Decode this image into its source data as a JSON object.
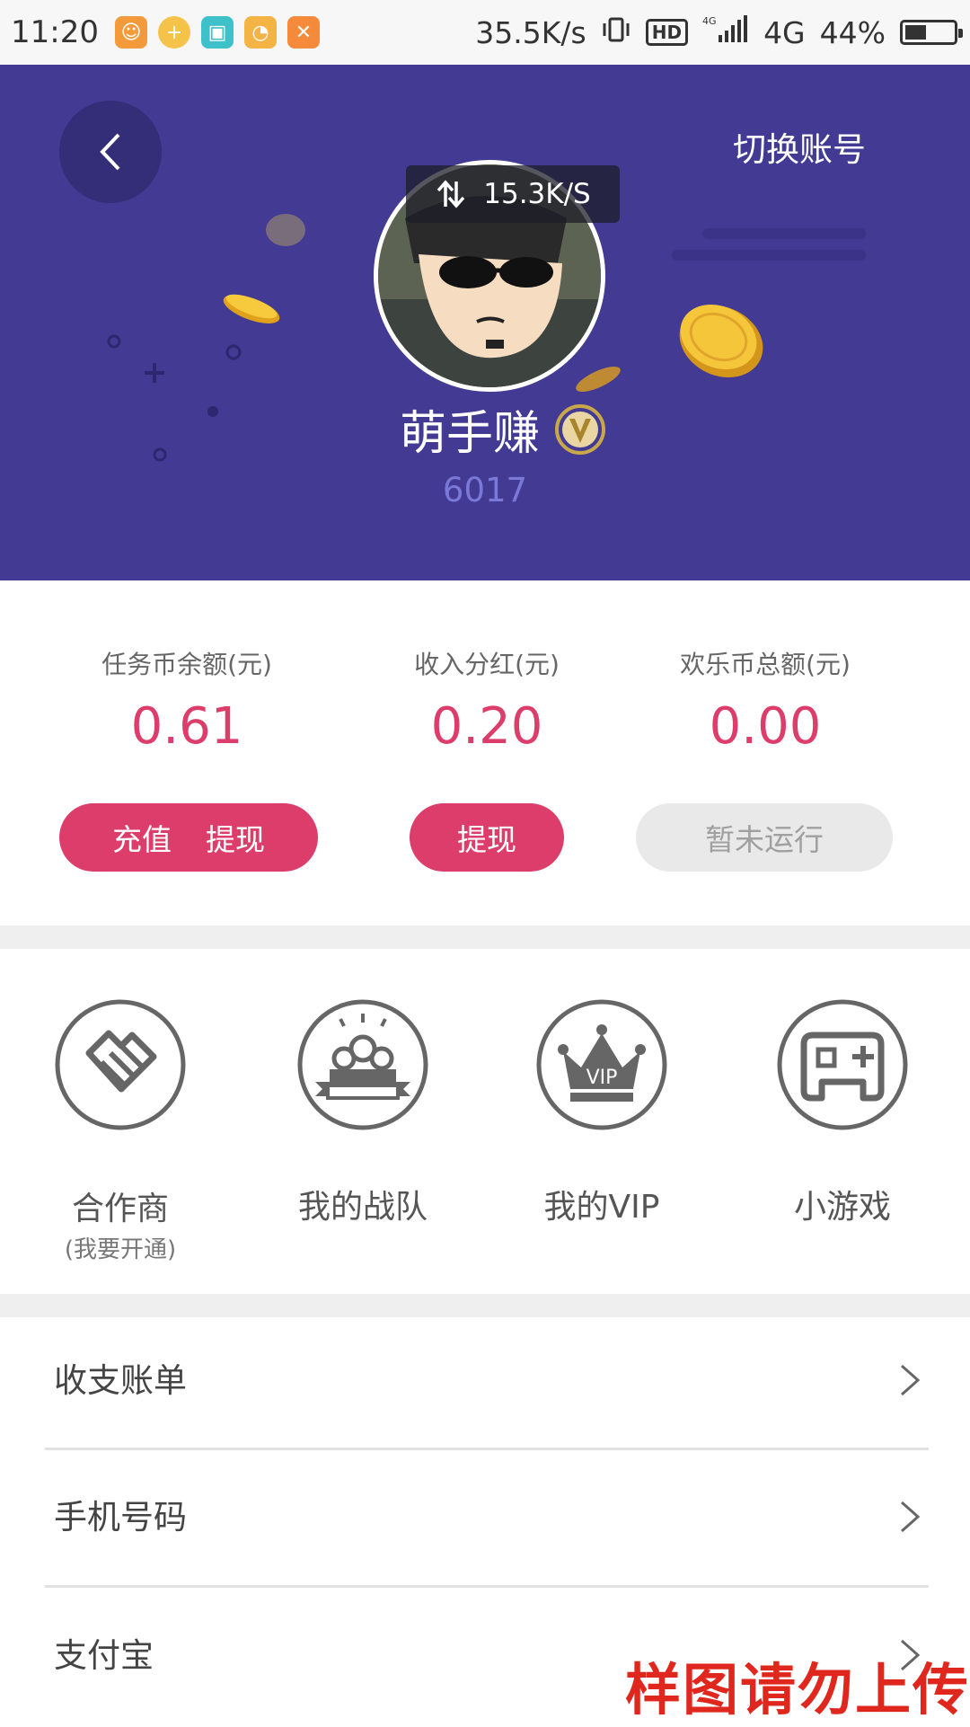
{
  "status_bar": {
    "time": "11:20",
    "network_speed": "35.5K/s",
    "hd": "HD",
    "network_type": "4G",
    "battery": "44%",
    "battery_level": 0.44,
    "app_icons": [
      "app-icon-orange",
      "app-icon-plus",
      "app-icon-scan",
      "app-icon-clock",
      "app-icon-shuffle"
    ]
  },
  "header": {
    "switch_account": "切换账号",
    "speed_overlay": "15.3K/S",
    "username": "萌手赚",
    "user_id": "6017",
    "background_color": "#423a93"
  },
  "balances": [
    {
      "label": "任务币余额(元)",
      "value": "0.61"
    },
    {
      "label": "收入分红(元)",
      "value": "0.20"
    },
    {
      "label": "欢乐币总额(元)",
      "value": "0.00"
    }
  ],
  "buttons": {
    "recharge": "充值",
    "withdraw_task": "提现",
    "withdraw_income": "提现",
    "not_running": "暂未运行"
  },
  "features": [
    {
      "label": "合作商",
      "sublabel": "(我要开通)",
      "icon": "handshake-icon"
    },
    {
      "label": "我的战队",
      "icon": "team-icon"
    },
    {
      "label": "我的VIP",
      "icon": "crown-icon",
      "icon_text": "VIP"
    },
    {
      "label": "小游戏",
      "icon": "gamepad-icon"
    }
  ],
  "menu": [
    {
      "label": "收支账单"
    },
    {
      "label": "手机号码"
    },
    {
      "label": "支付宝"
    }
  ],
  "watermark": "样图请勿上传",
  "colors": {
    "accent": "#dc3d6b",
    "header": "#423a93",
    "icon_gray": "#666666"
  }
}
